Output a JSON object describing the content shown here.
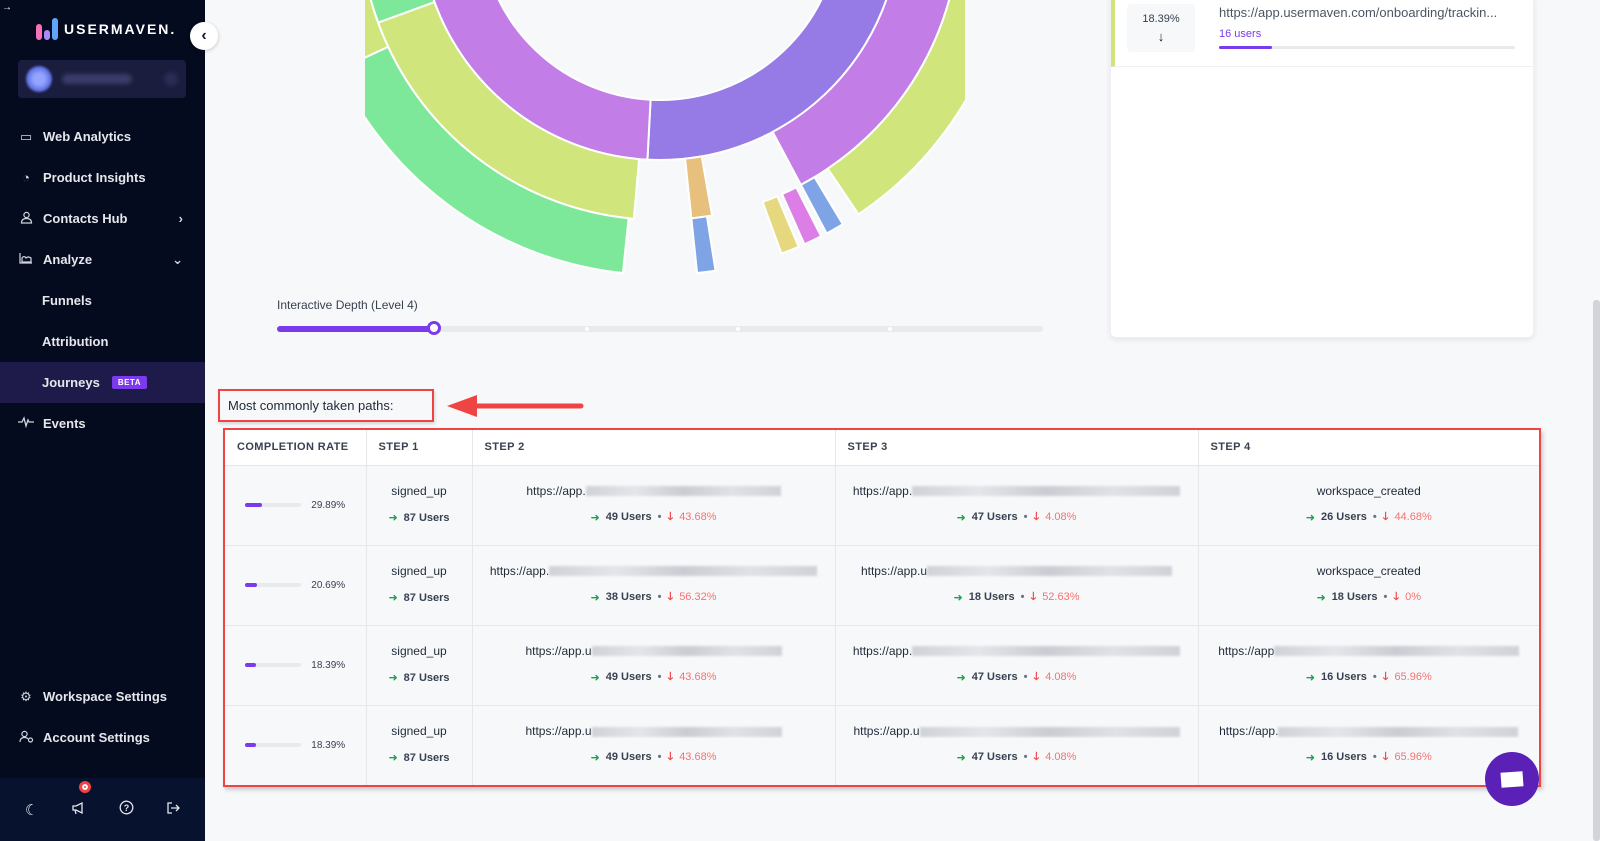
{
  "brand": {
    "name": "USERMAVEN.",
    "logo_colors": [
      "#f472b6",
      "#a78bfa",
      "#60a5fa"
    ]
  },
  "sidebar": {
    "collapse_icon": "chevron-left-icon",
    "workspace_name": "(blurred)",
    "items": [
      {
        "label": "Web Analytics",
        "icon": "browser-window-icon"
      },
      {
        "label": "Product Insights",
        "icon": "pie-chart-icon"
      },
      {
        "label": "Contacts Hub",
        "icon": "user-icon",
        "chevron": "›"
      },
      {
        "label": "Analyze",
        "icon": "area-chart-icon",
        "chevron": "⌄"
      },
      {
        "label": "Funnels",
        "sub": true
      },
      {
        "label": "Attribution",
        "sub": true
      },
      {
        "label": "Journeys",
        "sub": true,
        "active": true,
        "badge": "BETA"
      },
      {
        "label": "Events",
        "icon": "pulse-icon"
      }
    ],
    "bottom_items": [
      {
        "label": "Workspace Settings",
        "icon": "gear-icon"
      },
      {
        "label": "Account Settings",
        "icon": "user-settings-icon"
      }
    ],
    "footer_icons": [
      "moon-icon",
      "megaphone-icon",
      "help-icon",
      "logout-icon"
    ]
  },
  "journey": {
    "depth_label": "Interactive Depth (Level 4)",
    "depth_level": 4,
    "depth_max_steps": 5,
    "colors": {
      "blue": "#7e8ce8",
      "purple": "#c27de6",
      "violet": "#967be6",
      "lime": "#d0e67c",
      "green": "#7ee89a",
      "orange": "#e8c07e",
      "yellow": "#e6d87e",
      "pink": "#dc7ee6",
      "cornflower": "#7ea4e6"
    }
  },
  "detail_panel": {
    "percent": "18.39%",
    "arrow": "↓",
    "url": "https://app.usermaven.com/onboarding/trackin...",
    "users": "16 users",
    "users_fraction": 0.18
  },
  "paths": {
    "title": "Most commonly taken paths:",
    "headers": [
      "COMPLETION RATE",
      "STEP 1",
      "STEP 2",
      "STEP 3",
      "STEP 4"
    ],
    "rows": [
      {
        "rate": "29.89%",
        "rate_value": 0.2989,
        "steps": [
          {
            "name": "signed_up",
            "users": "87 Users",
            "drop": null
          },
          {
            "name": "https://app.",
            "blurred": true,
            "users": "49 Users",
            "drop": "43.68%"
          },
          {
            "name": "https://app.",
            "blurred": true,
            "users": "47 Users",
            "drop": "4.08%"
          },
          {
            "name": "workspace_created",
            "users": "26 Users",
            "drop": "44.68%"
          }
        ]
      },
      {
        "rate": "20.69%",
        "rate_value": 0.2069,
        "steps": [
          {
            "name": "signed_up",
            "users": "87 Users",
            "drop": null
          },
          {
            "name": "https://app.",
            "blurred": true,
            "users": "38 Users",
            "drop": "56.32%"
          },
          {
            "name": "https://app.u",
            "blurred": true,
            "users": "18 Users",
            "drop": "52.63%"
          },
          {
            "name": "workspace_created",
            "users": "18 Users",
            "drop": "0%"
          }
        ]
      },
      {
        "rate": "18.39%",
        "rate_value": 0.1839,
        "steps": [
          {
            "name": "signed_up",
            "users": "87 Users",
            "drop": null
          },
          {
            "name": "https://app.u",
            "blurred": true,
            "users": "49 Users",
            "drop": "43.68%"
          },
          {
            "name": "https://app.",
            "blurred": true,
            "users": "47 Users",
            "drop": "4.08%"
          },
          {
            "name": "https://app",
            "blurred": true,
            "users": "16 Users",
            "drop": "65.96%"
          }
        ]
      },
      {
        "rate": "18.39%",
        "rate_value": 0.1839,
        "steps": [
          {
            "name": "signed_up",
            "users": "87 Users",
            "drop": null
          },
          {
            "name": "https://app.u",
            "blurred": true,
            "users": "49 Users",
            "drop": "43.68%"
          },
          {
            "name": "https://app.u",
            "blurred": true,
            "users": "47 Users",
            "drop": "4.08%"
          },
          {
            "name": "https://app.",
            "blurred": true,
            "users": "16 Users",
            "drop": "65.96%"
          }
        ]
      }
    ]
  },
  "chat": {
    "icon": "chat-icon"
  }
}
